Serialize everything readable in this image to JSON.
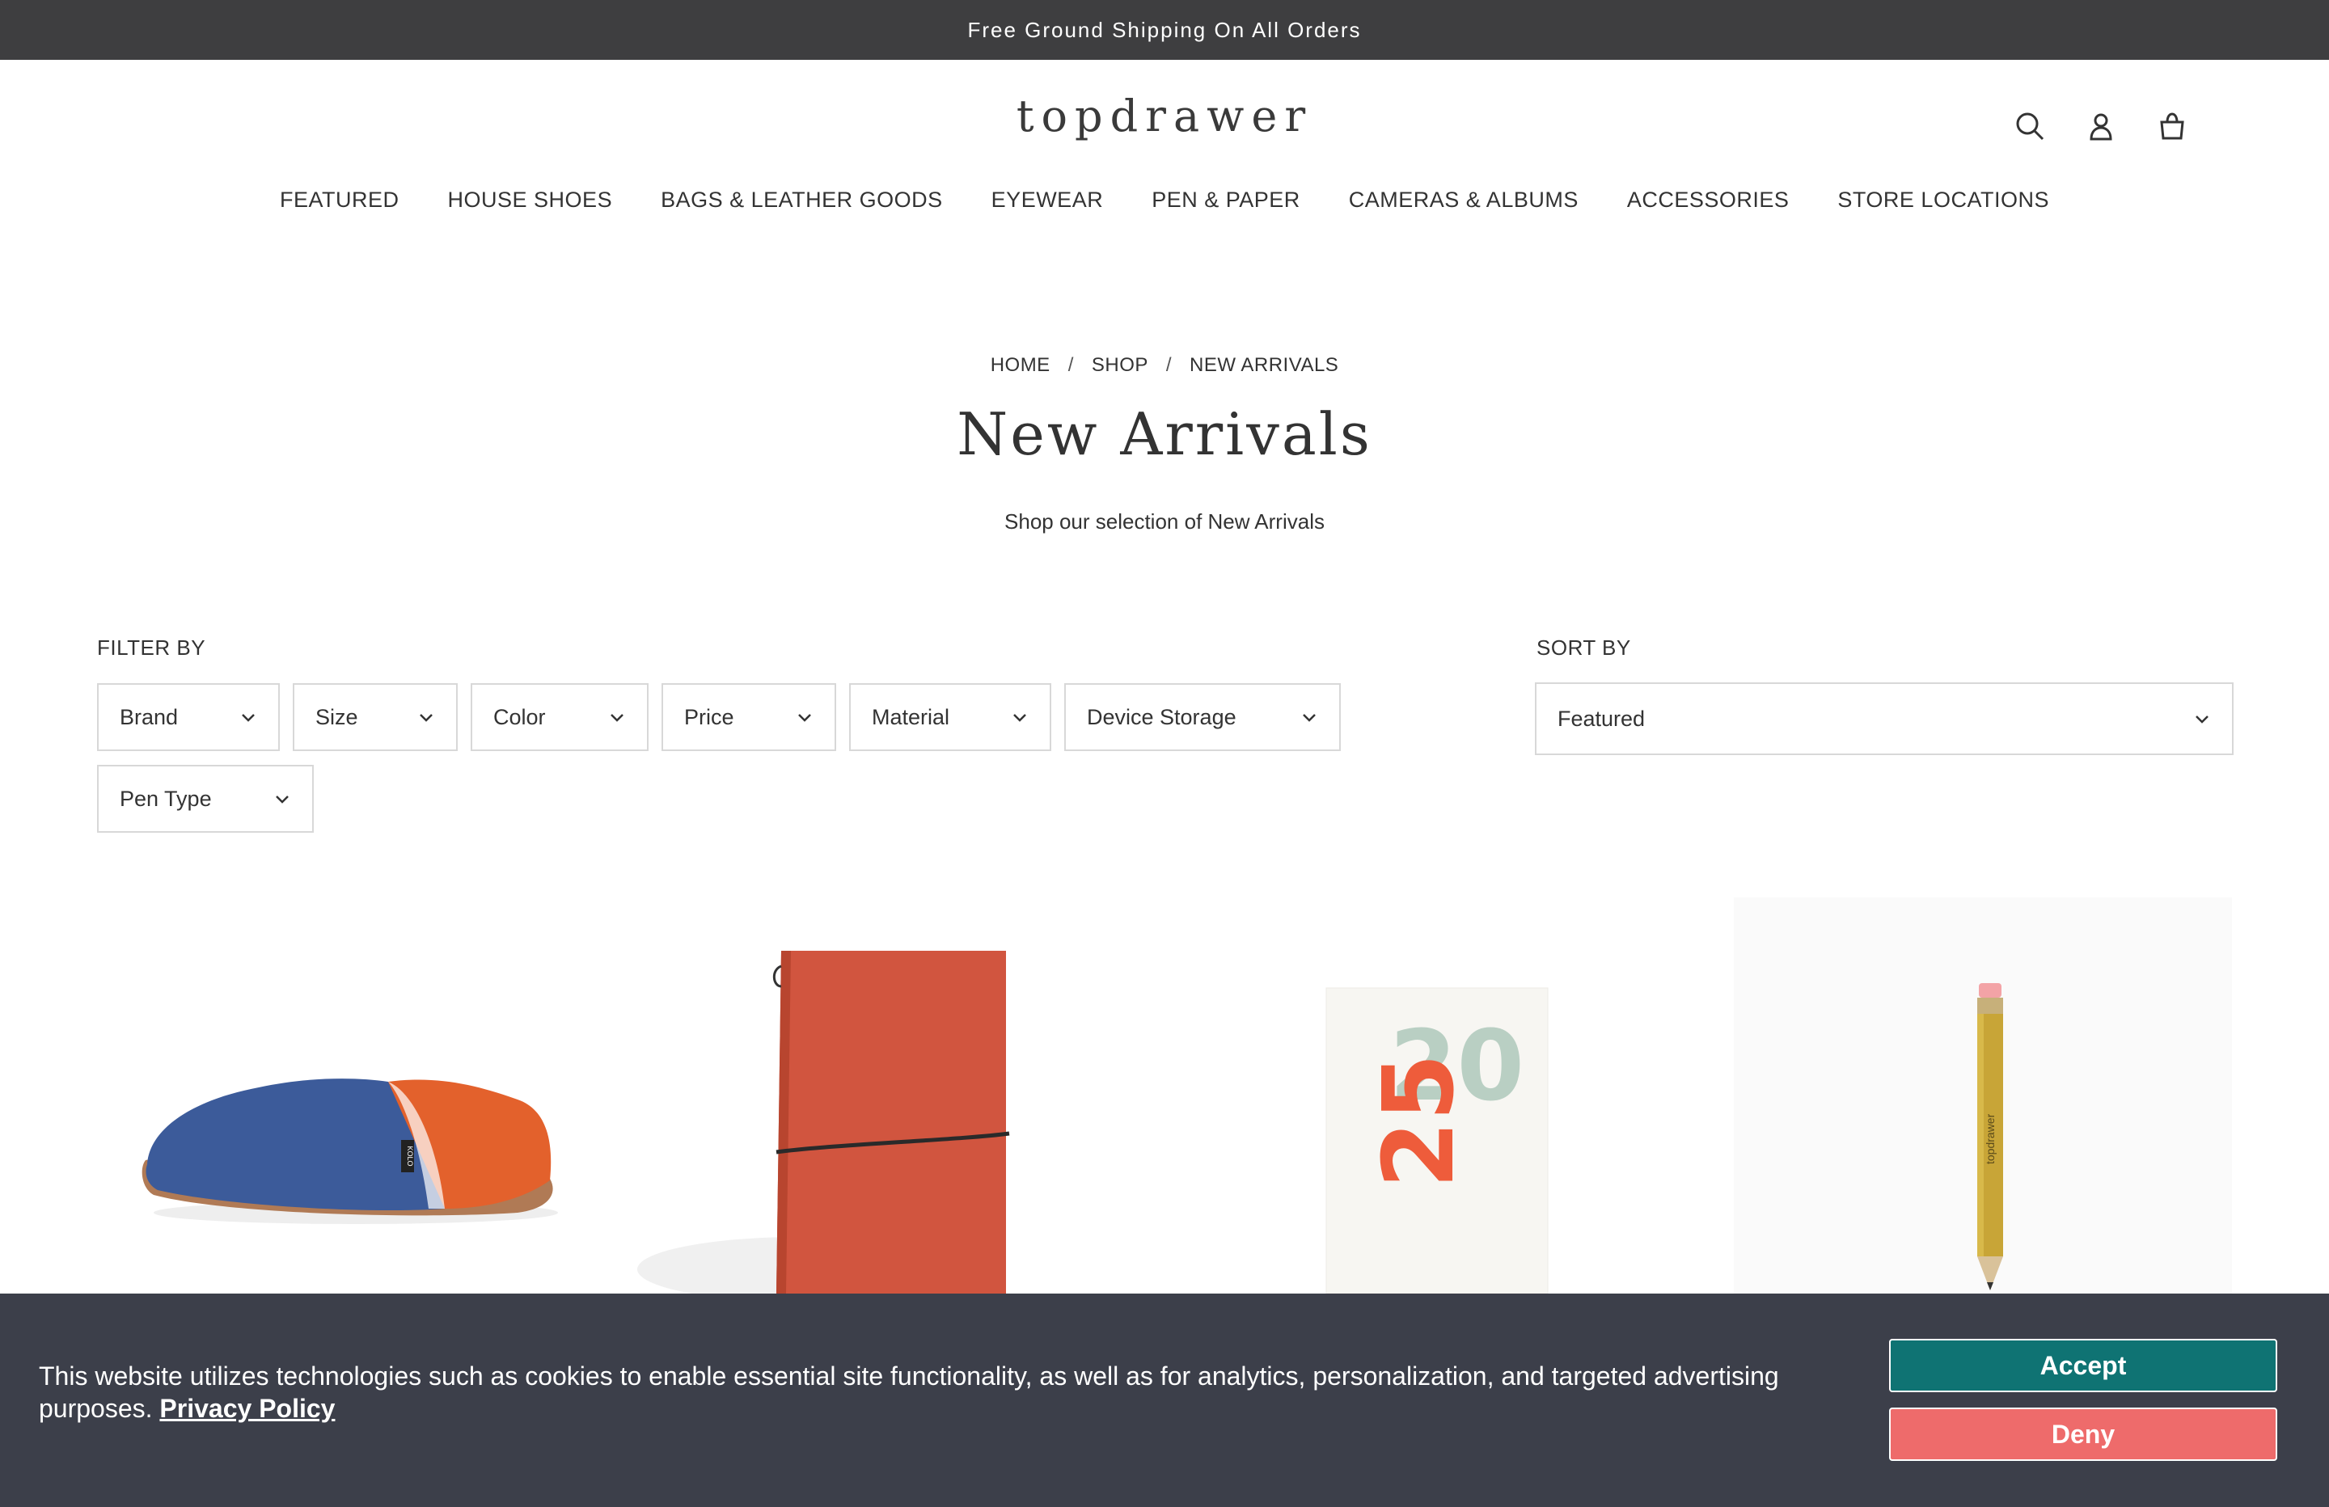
{
  "announcement": "Free Ground Shipping On All Orders",
  "header": {
    "logo": "topdrawer",
    "icons": [
      "search-icon",
      "account-icon",
      "cart-icon"
    ]
  },
  "nav": {
    "items": [
      "FEATURED",
      "HOUSE SHOES",
      "BAGS & LEATHER GOODS",
      "EYEWEAR",
      "PEN & PAPER",
      "CAMERAS & ALBUMS",
      "ACCESSORIES",
      "STORE LOCATIONS"
    ]
  },
  "breadcrumb": {
    "home": "HOME",
    "shop": "SHOP",
    "current": "NEW ARRIVALS",
    "separator": "/"
  },
  "page": {
    "title": "New Arrivals",
    "subtitle": "Shop our selection of New Arrivals"
  },
  "filters": {
    "label": "FILTER BY",
    "items": [
      "Brand",
      "Size",
      "Color",
      "Price",
      "Material",
      "Device Storage",
      "Pen Type"
    ]
  },
  "sort": {
    "label": "SORT BY",
    "selected": "Featured"
  },
  "products": {
    "planner_digits_top": "20",
    "planner_digits_bottom": "25",
    "slipper_tag": "KOLO",
    "pencil_text": "topdrawer"
  },
  "cookie": {
    "message": "This website utilizes technologies such as cookies to enable essential site functionality, as well as for analytics, personalization, and targeted advertising purposes.",
    "policy_link": "Privacy Policy",
    "accept": "Accept",
    "deny": "Deny",
    "accept_color": "#0f7373",
    "deny_color": "#ee6b6b"
  }
}
